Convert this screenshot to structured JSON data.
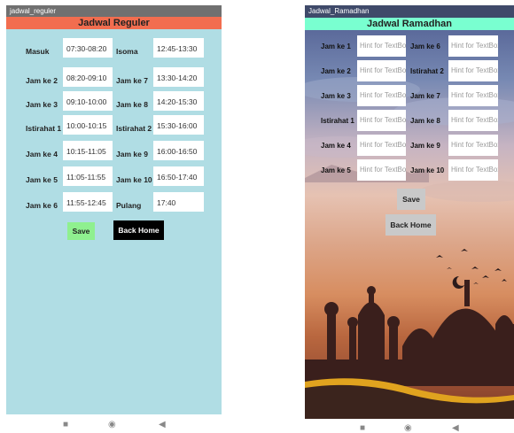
{
  "left_screen": {
    "title": "jadwal_reguler",
    "header": "Jadwal Reguler",
    "rows": [
      {
        "l1": "Masuk",
        "v1": "07:30-08:20",
        "l2": "Isoma",
        "v2": "12:45-13:30"
      },
      {
        "l1": "Jam ke 2",
        "v1": "08:20-09:10",
        "l2": "Jam ke 7",
        "v2": "13:30-14:20"
      },
      {
        "l1": "Jam ke 3",
        "v1": "09:10-10:00",
        "l2": "Jam ke 8",
        "v2": "14:20-15:30"
      },
      {
        "l1": "Istirahat 1",
        "v1": "10:00-10:15",
        "l2": "Istirahat 2",
        "v2": "15:30-16:00"
      },
      {
        "l1": "Jam ke 4",
        "v1": "10:15-11:05",
        "l2": "Jam ke 9",
        "v2": "16:00-16:50"
      },
      {
        "l1": "Jam ke 5",
        "v1": "11:05-11:55",
        "l2": "Jam ke 10",
        "v2": "16:50-17:40"
      },
      {
        "l1": "Jam ke 6",
        "v1": "11:55-12:45",
        "l2": "Pulang",
        "v2": "17:40"
      }
    ],
    "save_label": "Save",
    "back_label": "Back Home"
  },
  "right_screen": {
    "title": "Jadwal_Ramadhan",
    "header": "Jadwal Ramadhan",
    "placeholder": "Hint for TextBox",
    "rows": [
      {
        "l1": "Jam ke 1",
        "l2": "Jam ke 6"
      },
      {
        "l1": "Jam ke 2",
        "l2": "Istirahat 2"
      },
      {
        "l1": "Jam ke 3",
        "l2": "Jam ke 7"
      },
      {
        "l1": "Istirahat 1",
        "l2": "Jam ke 8"
      },
      {
        "l1": "Jam ke 4",
        "l2": "Jam ke 9"
      },
      {
        "l1": "Jam ke 5",
        "l2": "Jam ke 10"
      }
    ],
    "save_label": "Save",
    "back_label": "Back Home"
  },
  "navbar": {
    "square": "■",
    "circle": "◉",
    "back": "◀"
  },
  "colors": {
    "left_bg": "#b0dde4",
    "left_header": "#f26d4f",
    "save_button": "#8ff08f",
    "back_button": "#000000",
    "right_header": "#79ffd0",
    "right_button": "#c9c9c9"
  }
}
